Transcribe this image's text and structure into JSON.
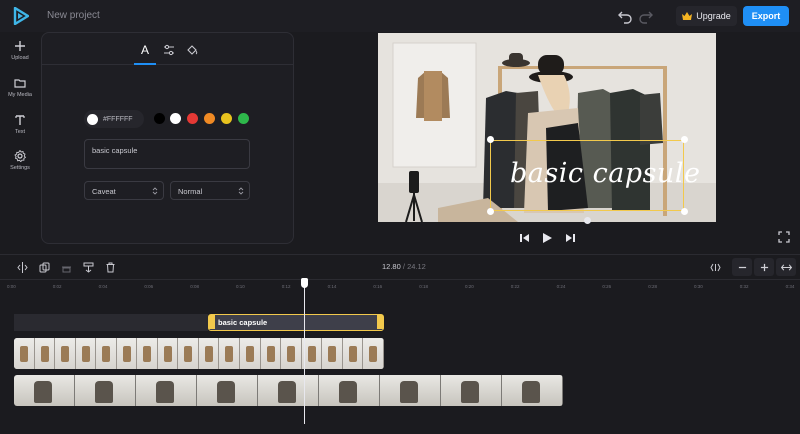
{
  "header": {
    "project_title": "New project",
    "upgrade_label": "Upgrade",
    "export_label": "Export"
  },
  "sidebar": {
    "items": [
      {
        "label": "Upload",
        "icon": "plus-icon"
      },
      {
        "label": "My Media",
        "icon": "folder-icon"
      },
      {
        "label": "Text",
        "icon": "text-icon"
      },
      {
        "label": "Settings",
        "icon": "gear-icon"
      }
    ]
  },
  "text_panel": {
    "tabs": [
      "font-tab",
      "style-tab",
      "fill-tab"
    ],
    "tab_font_label": "A",
    "color_hex": "#FFFFFF",
    "swatches": [
      "#000000",
      "#ffffff",
      "#e53935",
      "#f08a24",
      "#e8c31e",
      "#2eb84b"
    ],
    "text_value": "basic capsule",
    "font_value": "Caveat",
    "weight_value": "Normal"
  },
  "preview": {
    "overlay_text": "basic capsule"
  },
  "timeline": {
    "current_time": "12.80",
    "separator": "/",
    "total_time": "24.12",
    "ticks": [
      "0:00",
      "0:02",
      "0:04",
      "0:06",
      "0:08",
      "0:10",
      "0:12",
      "0:14",
      "0:16",
      "0:18",
      "0:20",
      "0:22",
      "0:24",
      "0:26",
      "0:28",
      "0:30",
      "0:32",
      "0:34"
    ],
    "text_clip_label": "basic capsule"
  },
  "colors": {
    "accent": "#1f8ff5",
    "selection": "#f2c94c",
    "background": "#1b1b1f"
  }
}
